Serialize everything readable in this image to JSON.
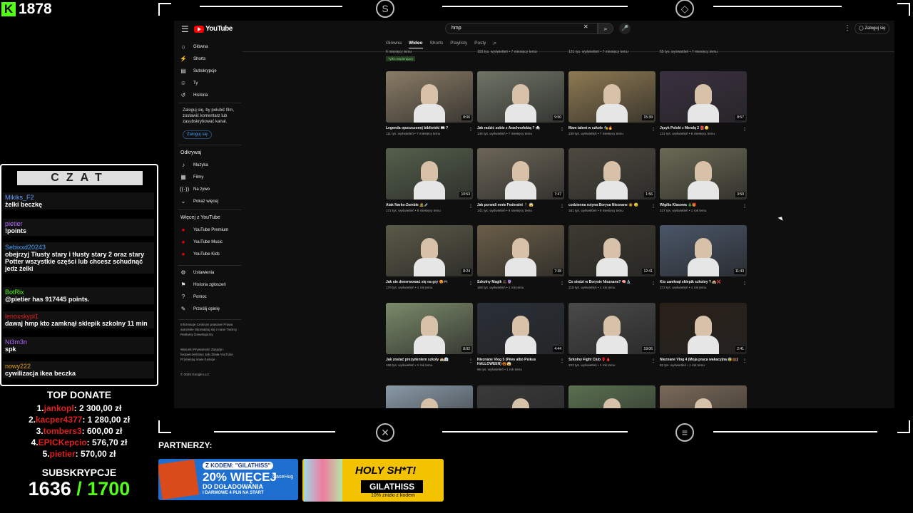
{
  "stream": {
    "kick_count": "1878",
    "chat_header": "CZAT",
    "chat": [
      {
        "nick": "Mikiks_F2",
        "text": "żelki beczkę",
        "color": "#6a9cff"
      },
      {
        "nick": "pietier",
        "text": "!points",
        "color": "#b36bff"
      },
      {
        "nick": "Sebixxd20243",
        "text": "obejrzyj Tłusty stary i tłusty stary 2 oraz stary Potter wszystkie części lub chcesz schudnąć jedz żelki",
        "color": "#4aa0ff"
      },
      {
        "nick": "BotRix",
        "text": "@pietier has 917445 points.",
        "color": "#53fc18"
      },
      {
        "nick": "lenoxskypl1",
        "text": "dawaj hmp kto zamknął sklepik szkolny 11 min",
        "color": "#e02020"
      },
      {
        "nick": "Ni3m3n",
        "text": "spk",
        "color": "#b36bff"
      },
      {
        "nick": "nowy222",
        "text": "cywilizacja ikea beczka",
        "color": "#e0a020"
      }
    ],
    "top_donate_title": "TOP DONATE",
    "donations": [
      {
        "rank": "1.",
        "name": "jankopl",
        "amount": ": 2 300,00 zł"
      },
      {
        "rank": "2.",
        "name": "kacper4377",
        "amount": ": 1 280,00 zł"
      },
      {
        "rank": "3.",
        "name": "tombers3",
        "amount": ": 600,00 zł"
      },
      {
        "rank": "4.",
        "name": "EPICKepcio",
        "amount": ": 576,70 zł"
      },
      {
        "rank": "5.",
        "name": "pietier",
        "amount": ": 570,00 zł"
      }
    ],
    "subs_title": "SUBSKRYPCJE",
    "subs_current": "1636",
    "subs_goal": "/ 1700",
    "partners_label": "PARTNERZY:",
    "ad1": {
      "code": "Z KODEM: \"GILATHISS\"",
      "headline": "20% WIĘCEJ",
      "sub": "DO DOŁADOWANIA",
      "small": "I DARMOWE 4 PLN NA START",
      "brand": "CaseHug"
    },
    "ad2": {
      "headline": "HOLY SH*T!",
      "code": "GILATHISS",
      "small": "10% zniżki z kodem"
    }
  },
  "youtube": {
    "logo_text": "YouTube",
    "search_value": "hmp",
    "signin_label": "Zaloguj się",
    "sidebar": {
      "main": [
        "Główna",
        "Shorts",
        "Subskrypcje",
        "Ty",
        "Historia"
      ],
      "note": "Zaloguj się, by polubić film, zostawić komentarz lub zasubskrybować kanał.",
      "note_button": "Zaloguj się",
      "explore_title": "Odkrywaj",
      "explore": [
        "Muzyka",
        "Filmy",
        "Na żywo",
        "Pokaż więcej"
      ],
      "more_title": "Więcej z YouTube",
      "more": [
        "YouTube Premium",
        "YouTube Music",
        "YouTube Kids"
      ],
      "settings": [
        "Ustawienia",
        "Historia zgłoszeń",
        "Pomoc",
        "Prześlij opinię"
      ],
      "footer1": "Informacje  Centrum prasowe  Prawa autorskie  Skontaktuj się z nami  Twórcy  Reklamy  Deweloperzy",
      "footer2": "Warunki  Prywatność  Zasady i bezpieczeństwo  Jak działa YouTube  Przetestuj nowe funkcje",
      "copyright": "© 2026 Google LLC"
    },
    "tabs": [
      "Główna",
      "Wideo",
      "Shorts",
      "Playlisty",
      "Posty"
    ],
    "prev_meta": [
      "6 miesięcy temu",
      "103 tys. wyświetleń • 7 miesięcy temu",
      "121 tys. wyświetleń • 7 miesięcy temu",
      "55 tys. wyświetleń • 7 miesięcy temu"
    ],
    "only_members": "Tylko wspierający",
    "videos": [
      {
        "title": "Legenda opuszczonej biblioteki 📖 ?",
        "meta": "111 tys. wyświetleń • 7 miesięcy temu",
        "dur": "8:06",
        "bg": "#8a7c66"
      },
      {
        "title": "Jak radzić sobie z Arachnofobią ? 🕷",
        "meta": "148 tys. wyświetleń • 7 miesięcy temu",
        "dur": "9:50",
        "bg": "#6f7466"
      },
      {
        "title": "Mam talent w szkole 🎭🔥",
        "meta": "239 tys. wyświetleń • 7 miesięcy temu",
        "dur": "15:39",
        "bg": "#8e7a52"
      },
      {
        "title": "Język Polski z Mendą 2 📕🙄",
        "meta": "131 tys. wyświetleń • 8 miesięcy temu",
        "dur": "8:57",
        "bg": "#3a3040"
      },
      {
        "title": "Atak Narko-Zombie 🧟💉",
        "meta": "172 tys. wyświetleń • 8 miesięcy temu",
        "dur": "10:53",
        "bg": "#55604c"
      },
      {
        "title": "Jak porwali mnie Federalni 🕴 😱",
        "meta": "141 tys. wyświetleń • 9 miesięcy temu",
        "dur": "7:47",
        "bg": "#6c6658"
      },
      {
        "title": "codzienna rutyna Borysa Nieznane 🧔 😴",
        "meta": "181 tys. wyświetleń • 9 miesięcy temu",
        "dur": "1:56",
        "bg": "#4e4a40"
      },
      {
        "title": "Wigilia Klasowa 🎄🎁",
        "meta": "227 tys. wyświetleń • 1 rok temu",
        "dur": "3:50",
        "bg": "#6b6a55"
      },
      {
        "title": "Jak nie denerwować się na gry 😡🎮",
        "meta": "179 tys. wyświetleń • 1 rok temu",
        "dur": "8:24",
        "bg": "#5a5a48"
      },
      {
        "title": "Szkolny Magik 🎩🔮",
        "meta": "168 tys. wyświetleń • 1 rok temu",
        "dur": "7:38",
        "bg": "#6a5e48"
      },
      {
        "title": "Co siedzi w Borysie Nieznane? 🧠🔬",
        "meta": "215 tys. wyświetleń • 1 rok temu",
        "dur": "12:41",
        "bg": "#3c3a30"
      },
      {
        "title": "Kto zamknął sklepik szkolny ? 🏫❌",
        "meta": "272 tys. wyświetleń • 1 rok temu",
        "dur": "11:43",
        "bg": "#4a5668"
      },
      {
        "title": "Jak zostać prezydentem szkoły 🏫👔",
        "meta": "186 tys. wyświetleń • 1 rok temu",
        "dur": "8:02",
        "bg": "#7a8a6a"
      },
      {
        "title": "Nieznane Vlog 5 (Piwo albo Psikus HALLOWEEN) 🎃😱",
        "meta": "86 tys. wyświetleń • 1 rok temu",
        "dur": "4:44",
        "bg": "#2a3038"
      },
      {
        "title": "Szkolny Fight Club 🥊🩸",
        "meta": "223 tys. wyświetleń • 1 rok temu",
        "dur": "19:06",
        "bg": "#4a4a4a"
      },
      {
        "title": "Nieznane Vlog 4 (Moja praca wakacyjna 😰💼)",
        "meta": "82 tys. wyświetleń • 1 rok temu",
        "dur": "2:41",
        "bg": "#2a2018"
      },
      {
        "title": "",
        "meta": "",
        "dur": "",
        "bg": "#8a9aa8"
      },
      {
        "title": "",
        "meta": "",
        "dur": "",
        "bg": "#3a3a3a"
      },
      {
        "title": "",
        "meta": "",
        "dur": "",
        "bg": "#5a7050"
      },
      {
        "title": "",
        "meta": "",
        "dur": "",
        "bg": "#7a6a5a"
      }
    ]
  }
}
